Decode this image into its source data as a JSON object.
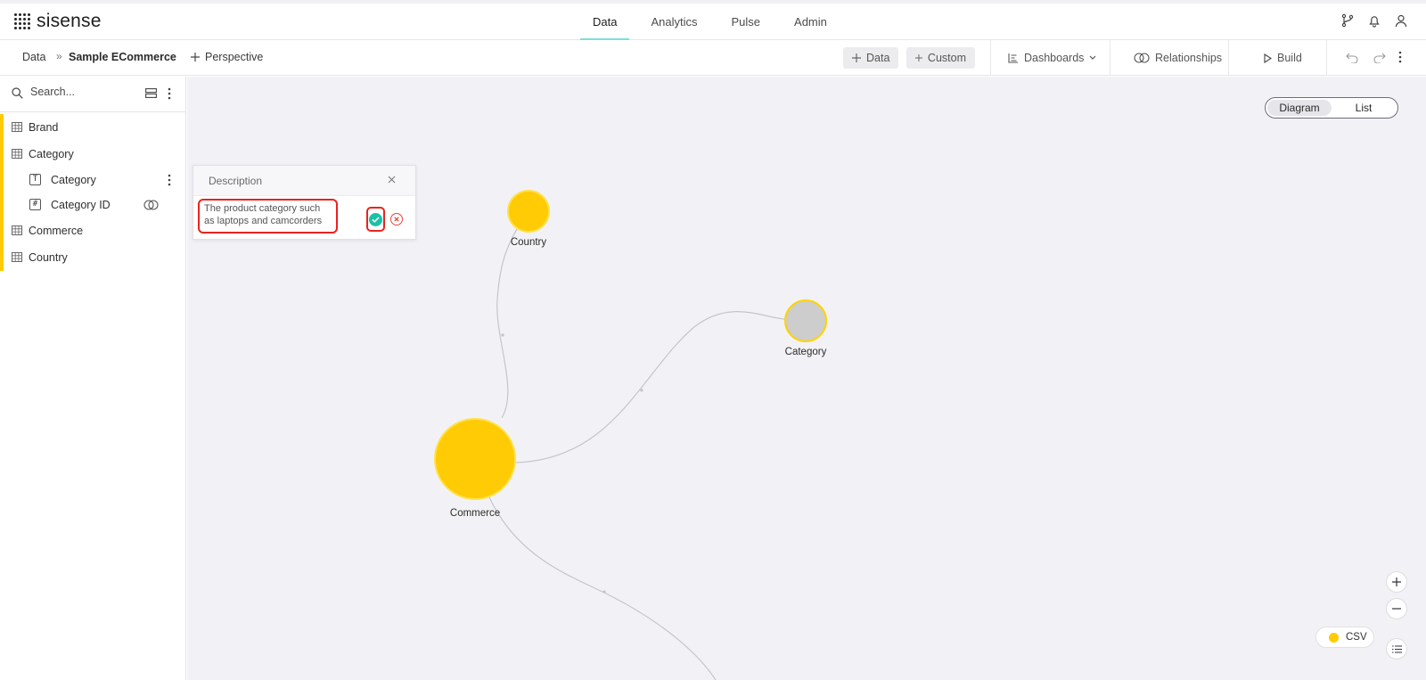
{
  "app": {
    "name": "sisense"
  },
  "nav": {
    "tabs": [
      {
        "label": "Data"
      },
      {
        "label": "Analytics"
      },
      {
        "label": "Pulse"
      },
      {
        "label": "Admin"
      }
    ],
    "active_tab": "Data"
  },
  "toolbar": {
    "breadcrumb_root": "Data",
    "breadcrumb_sep": "»",
    "model_name": "Sample ECommerce",
    "perspective_label": "Perspective",
    "add_data_label": "Data",
    "add_custom_label": "Custom",
    "dashboards_label": "Dashboards",
    "relationships_label": "Relationships",
    "build_label": "Build"
  },
  "sidebar": {
    "search_placeholder": "Search...",
    "tables": [
      {
        "label": "Brand"
      },
      {
        "label": "Category"
      },
      {
        "label": "Commerce"
      },
      {
        "label": "Country"
      }
    ],
    "category_fields": [
      {
        "label": "Category",
        "type_glyph": "T"
      },
      {
        "label": "Category ID",
        "type_glyph": "#"
      }
    ]
  },
  "canvas": {
    "view_toggle": {
      "options": [
        "Diagram",
        "List"
      ],
      "active": "Diagram"
    },
    "nodes": [
      {
        "label": "Country",
        "color": "#ffcb05"
      },
      {
        "label": "Category",
        "color": "#cdcdcd"
      },
      {
        "label": "Commerce",
        "color": "#ffcb05"
      }
    ],
    "legend": {
      "label": "CSV",
      "color": "#ffcb05"
    }
  },
  "description_popup": {
    "title": "Description",
    "text": "The product category such as laptops and camcorders"
  },
  "colors": {
    "accent_teal": "#7ddfd9",
    "table_yellow": "#ffcb05",
    "confirm_green": "#1bc1a7",
    "highlight_red": "#e8231f"
  }
}
